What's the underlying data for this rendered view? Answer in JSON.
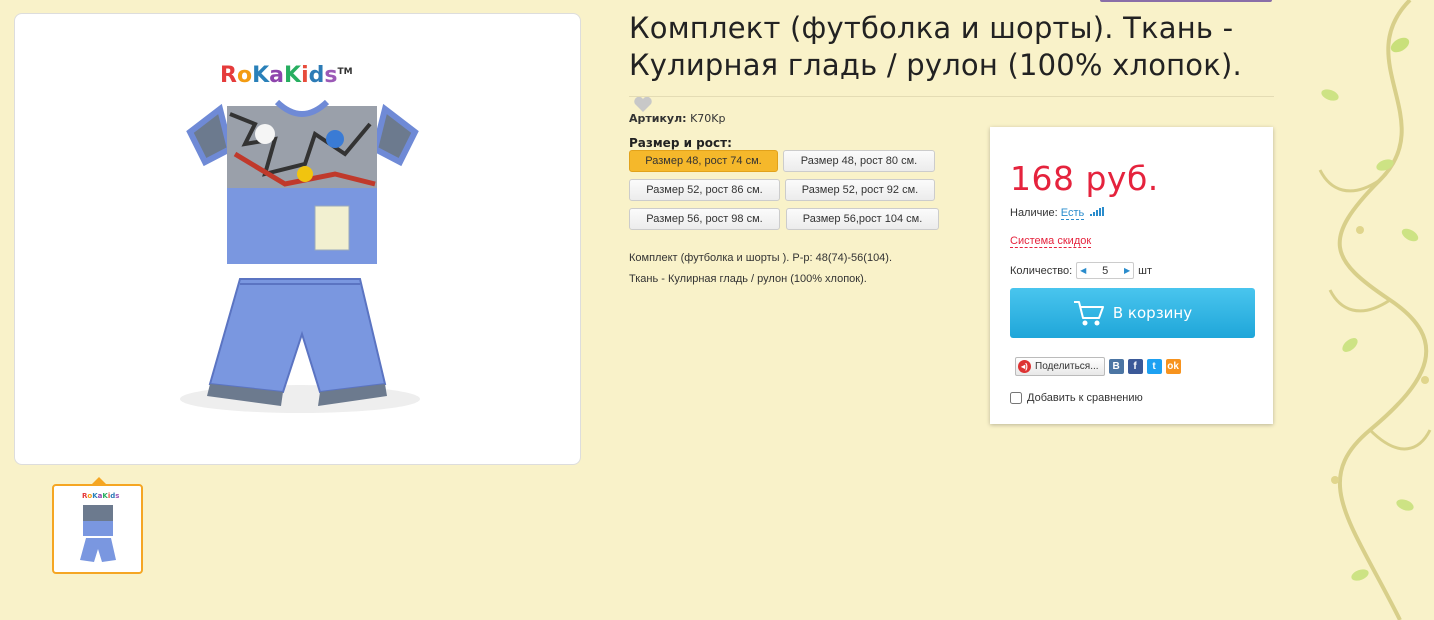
{
  "product": {
    "title": "Комплект (футболка и шорты). Ткань - Кулирная гладь / рулон (100% хлопок).",
    "sku_label": "Артикул:",
    "sku_value": "K70Kp",
    "size_label": "Размер и рост:",
    "sizes": [
      "Размер 48, рост 74 см.",
      "Размер 48, рост 80 см.",
      "Размер 52, рост 86 см.",
      "Размер 52, рост 92 см.",
      "Размер 56, рост 98 см.",
      "Размер 56,рост 104 см."
    ],
    "selected_size_index": 0,
    "description_line1": "Комплект (футболка и шорты ). Р-р: 48(74)-56(104).",
    "description_line2": "Ткань - Кулирная гладь / рулон (100% хлопок).",
    "brand_logo_text": "RoKaKids™"
  },
  "buy_box": {
    "price": "168 руб.",
    "stock_label": "Наличие:",
    "stock_value": "Есть",
    "discount_link": "Система скидок",
    "qty_label": "Количество:",
    "qty_value": "5",
    "qty_unit": "шт",
    "cart_button": "В корзину",
    "share_button": "Поделиться...",
    "compare_label": "Добавить к сравнению"
  },
  "colors": {
    "background": "#f9f2c9",
    "price": "#e5233d",
    "cart_button": "#2fb3e2",
    "active_size": "#f5b82b",
    "thumb_border": "#f5a623"
  },
  "icons": [
    "heart-icon",
    "cart-icon",
    "signal-icon",
    "share-icon",
    "vk-icon",
    "facebook-icon",
    "twitter-icon",
    "odnoklassniki-icon"
  ]
}
